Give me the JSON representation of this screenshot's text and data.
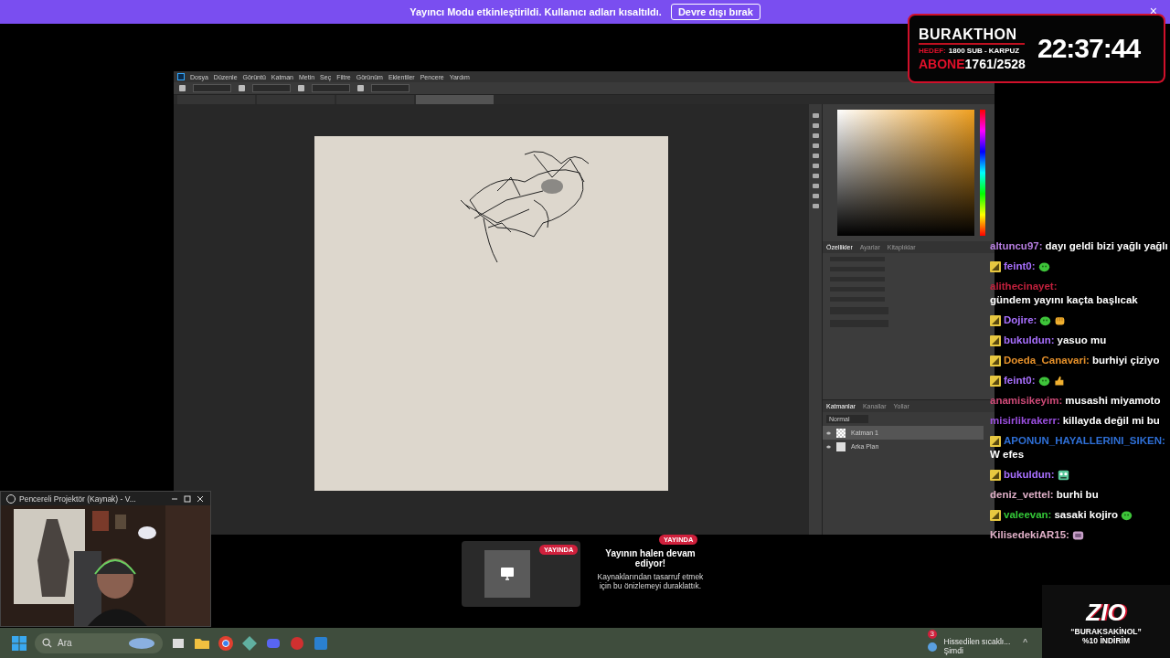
{
  "banner": {
    "text": "Yayıncı Modu etkinleştirildi. Kullanıcı adları kısaltıldı.",
    "button": "Devre dışı bırak",
    "close": "×"
  },
  "timer": {
    "title": "BURAKTHON",
    "goal_label": "HEDEF:",
    "goal": "1800 SUB - KARPUZ",
    "subs_label": "ABONE",
    "subs": "1761/2528",
    "time": "22:37:44"
  },
  "photoshop": {
    "menu": [
      "Dosya",
      "Düzenle",
      "Görüntü",
      "Katman",
      "Metin",
      "Seç",
      "Filtre",
      "Görünüm",
      "Eklentiler",
      "Pencere",
      "Yardım"
    ],
    "doc_tabs": [
      {
        "selected": false
      },
      {
        "selected": false
      },
      {
        "selected": false
      },
      {
        "selected": true
      }
    ],
    "properties_tabs": [
      {
        "label": "Özellikler",
        "selected": true
      },
      {
        "label": "Ayarlar",
        "selected": false
      },
      {
        "label": "Kitaplıklar",
        "selected": false
      }
    ],
    "layers_tabs": [
      {
        "label": "Katmanlar",
        "selected": true
      },
      {
        "label": "Kanallar",
        "selected": false
      },
      {
        "label": "Yollar",
        "selected": false
      }
    ],
    "blend_mode": "Normal",
    "layers": [
      {
        "name": "Katman 1",
        "selected": true,
        "kind": "transparent"
      },
      {
        "name": "Arka Plan",
        "selected": false,
        "kind": "background"
      }
    ]
  },
  "chat": [
    {
      "badge": false,
      "user": "altuncu97:",
      "color": "#b77ee0",
      "text": "dayı geldi bizi yağlı yağlı"
    },
    {
      "badge": true,
      "user": "feint0:",
      "color": "#a970ff",
      "emotes": [
        {
          "kind": "blob"
        }
      ]
    },
    {
      "badge": false,
      "user": "alithecinayet:",
      "color": "#c0203c",
      "text": "gündem yayını kaçta başlıcak"
    },
    {
      "badge": true,
      "user": "Dojire:",
      "color": "#a970ff",
      "emotes": [
        {
          "kind": "blob"
        },
        {
          "kind": "fist"
        }
      ]
    },
    {
      "badge": true,
      "user": "bukuldun:",
      "color": "#a970ff",
      "text": "yasuo mu"
    },
    {
      "badge": true,
      "user": "Doeda_Canavari:",
      "color": "#e5902a",
      "text": "burhiyi çiziyo"
    },
    {
      "badge": true,
      "user": "feint0:",
      "color": "#a970ff",
      "emotes": [
        {
          "kind": "blob"
        },
        {
          "kind": "thumb"
        }
      ]
    },
    {
      "badge": false,
      "user": "anamisikeyim:",
      "color": "#d04a78",
      "text": "musashi miyamoto"
    },
    {
      "badge": false,
      "user": "misirlikrakerr:",
      "color": "#9b4fe0",
      "text": "killayda değil mi bu"
    },
    {
      "badge": true,
      "user": "APONUN_HAYALLERINI_SIKEN:",
      "color": "#2e6fd6",
      "text": "W efes"
    },
    {
      "badge": true,
      "user": "bukuldun:",
      "color": "#a970ff",
      "emotes": [
        {
          "kind": "face"
        }
      ]
    },
    {
      "badge": false,
      "user": "deniz_vettel:",
      "color": "#e0b0c8",
      "text": "burhi bu"
    },
    {
      "badge": true,
      "user": "valeevan:",
      "color": "#34c838",
      "text": "sasaki kojiro",
      "emotes": [
        {
          "kind": "blob"
        }
      ]
    },
    {
      "badge": false,
      "user": "KilisedekiAR15:",
      "color": "#e0b0c8",
      "emotes": [
        {
          "kind": "cat"
        }
      ]
    }
  ],
  "projector": {
    "title": "Pencereli Projektör (Kaynak) - V..."
  },
  "notice": {
    "badges": [
      "YAYINDA",
      "YAYINDA"
    ],
    "title": "Yayının halen devam ediyor!",
    "body": "Kaynaklarından tasarruf etmek için bu önizlemeyi duraklattık."
  },
  "taskbar": {
    "search_placeholder": "Ara",
    "weather": "Hissedilen sıcaklı...",
    "weather_sub": "Şimdi",
    "notification_count": "3",
    "tray_caret": "^"
  },
  "ad": {
    "logo": "ZIO",
    "line1": "“BURAKSAKİNOL”",
    "line2": "%10 İNDİRİM"
  }
}
